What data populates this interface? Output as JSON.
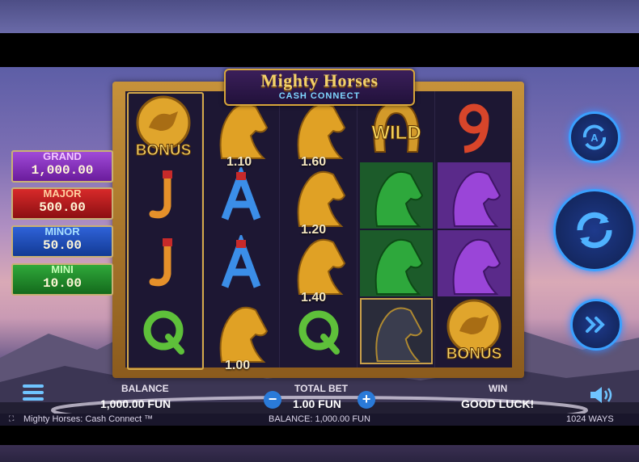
{
  "game": {
    "title_line1": "Mighty Horses",
    "title_line2": "CASH CONNECT"
  },
  "jackpots": [
    {
      "label": "GRAND",
      "value": "1,000.00",
      "color": "#8c2fc4"
    },
    {
      "label": "MAJOR",
      "value": "500.00",
      "color": "#c0161c"
    },
    {
      "label": "MINOR",
      "value": "50.00",
      "color": "#1f4fc0"
    },
    {
      "label": "MINI",
      "value": "10.00",
      "color": "#1e8f2a"
    }
  ],
  "reels": [
    [
      "BONUS",
      "J",
      "J",
      "Q"
    ],
    [
      "gold-horse",
      "A",
      "A",
      "gold-horse"
    ],
    [
      "gold-horse",
      "gold-horse",
      "gold-horse",
      "Q"
    ],
    [
      "WILD",
      "green-horse",
      "green-horse",
      "black-horse"
    ],
    [
      "9",
      "purple-horse",
      "purple-horse",
      "BONUS"
    ]
  ],
  "cash_values": [
    "1.10",
    "1.60",
    "1.20",
    "1.40",
    "1.00"
  ],
  "symbols": {
    "bonus_text": "BONUS",
    "wild_text": "WILD"
  },
  "hud": {
    "balance_label": "BALANCE",
    "balance_value": "1,000.00 FUN",
    "bet_label": "TOTAL BET",
    "bet_value": "1.00 FUN",
    "win_label": "WIN",
    "win_value": "GOOD LUCK!",
    "minus": "−",
    "plus": "+"
  },
  "status": {
    "game_name": "Mighty Horses: Cash Connect ™",
    "balance": "BALANCE: 1,000.00 FUN",
    "ways": "1024 WAYS"
  },
  "icons": {
    "autoplay": "A",
    "spin": "spin-arrows",
    "turbo": "double-chevron",
    "menu": "hamburger",
    "sound": "speaker"
  }
}
